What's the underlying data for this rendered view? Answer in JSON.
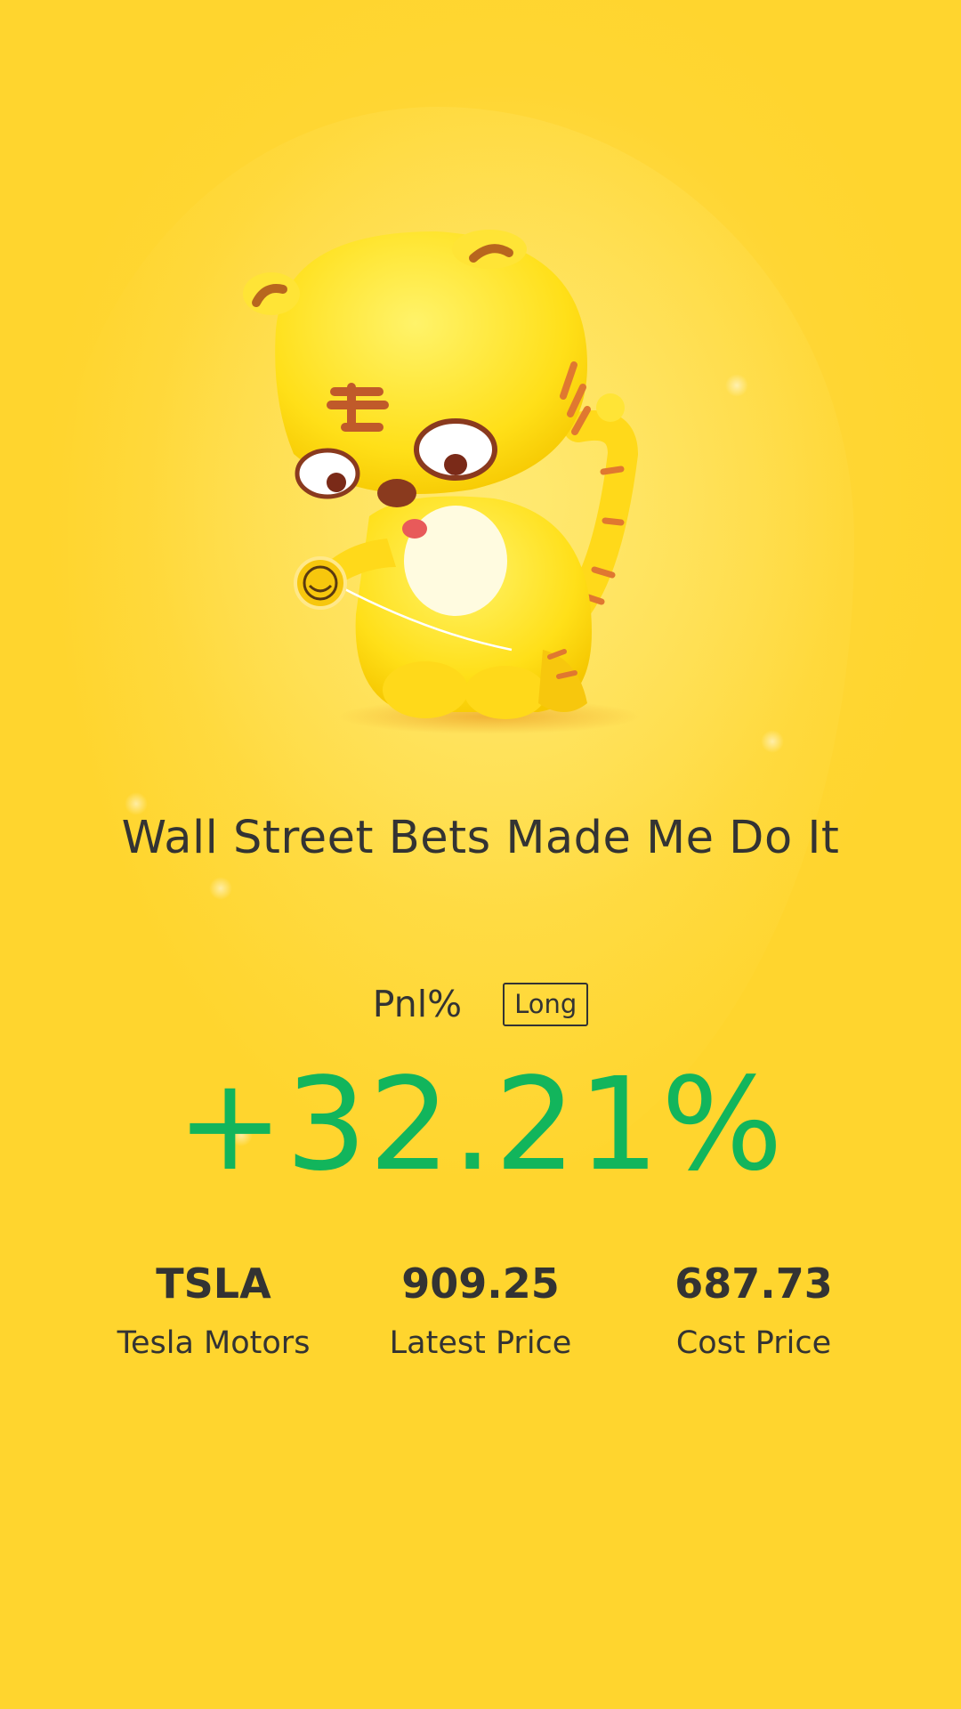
{
  "headline": "Wall Street Bets Made Me Do It",
  "pnl": {
    "label": "Pnl%",
    "side": "Long",
    "value": "+32.21%",
    "value_color": "#12b55c"
  },
  "stats": [
    {
      "value": "TSLA",
      "label": "Tesla Motors"
    },
    {
      "value": "909.25",
      "label": "Latest Price"
    },
    {
      "value": "687.73",
      "label": "Cost Price"
    }
  ],
  "mascot": {
    "icon": "tiger-mascot-icon"
  },
  "colors": {
    "background": "#ffd633",
    "text": "#333333",
    "gain": "#12b55c"
  }
}
